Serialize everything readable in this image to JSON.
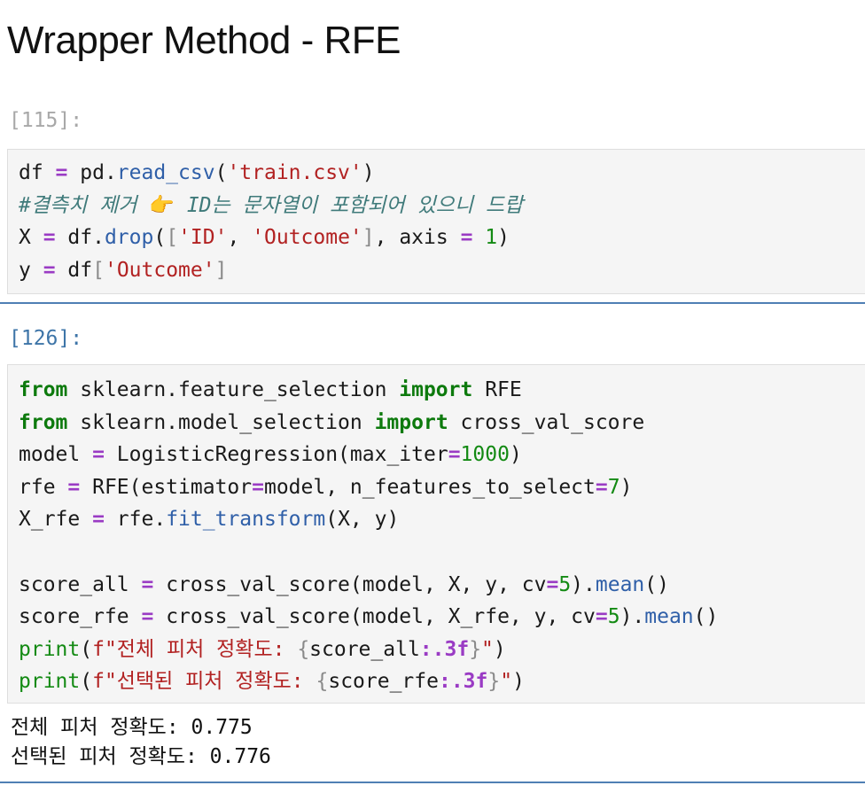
{
  "heading": "Wrapper Method - RFE",
  "cell1": {
    "prompt": "[115]:",
    "lines": [
      {
        "tokens": [
          {
            "t": "df ",
            "c": ""
          },
          {
            "t": "=",
            "c": "op"
          },
          {
            "t": " pd.",
            "c": ""
          },
          {
            "t": "read_csv",
            "c": "fn"
          },
          {
            "t": "(",
            "c": ""
          },
          {
            "t": "'train.csv'",
            "c": "str"
          },
          {
            "t": ")",
            "c": ""
          }
        ]
      },
      {
        "tokens": [
          {
            "t": "#결측치 제거 ",
            "c": "cm"
          },
          {
            "t": "👉",
            "c": "emoji"
          },
          {
            "t": " ID는 문자열이 포함되어 있으니 드랍",
            "c": "cm"
          }
        ]
      },
      {
        "tokens": [
          {
            "t": "X ",
            "c": ""
          },
          {
            "t": "=",
            "c": "op"
          },
          {
            "t": " df.",
            "c": ""
          },
          {
            "t": "drop",
            "c": "fn"
          },
          {
            "t": "(",
            "c": ""
          },
          {
            "t": "[",
            "c": "br"
          },
          {
            "t": "'ID'",
            "c": "str"
          },
          {
            "t": ", ",
            "c": ""
          },
          {
            "t": "'Outcome'",
            "c": "str"
          },
          {
            "t": "]",
            "c": "br"
          },
          {
            "t": ", axis ",
            "c": ""
          },
          {
            "t": "=",
            "c": "op"
          },
          {
            "t": " ",
            "c": ""
          },
          {
            "t": "1",
            "c": "num"
          },
          {
            "t": ")",
            "c": ""
          }
        ]
      },
      {
        "tokens": [
          {
            "t": "y ",
            "c": ""
          },
          {
            "t": "=",
            "c": "op"
          },
          {
            "t": " df",
            "c": ""
          },
          {
            "t": "[",
            "c": "br"
          },
          {
            "t": "'Outcome'",
            "c": "str"
          },
          {
            "t": "]",
            "c": "br"
          }
        ]
      }
    ]
  },
  "cell2": {
    "prompt": "[126]:",
    "lines": [
      {
        "tokens": [
          {
            "t": "from",
            "c": "kw"
          },
          {
            "t": " sklearn.feature_selection ",
            "c": ""
          },
          {
            "t": "import",
            "c": "kw"
          },
          {
            "t": " RFE",
            "c": ""
          }
        ]
      },
      {
        "tokens": [
          {
            "t": "from",
            "c": "kw"
          },
          {
            "t": " sklearn.model_selection ",
            "c": ""
          },
          {
            "t": "import",
            "c": "kw"
          },
          {
            "t": " cross_val_score",
            "c": ""
          }
        ]
      },
      {
        "tokens": [
          {
            "t": "model ",
            "c": ""
          },
          {
            "t": "=",
            "c": "op"
          },
          {
            "t": " LogisticRegression(max_iter",
            "c": ""
          },
          {
            "t": "=",
            "c": "op"
          },
          {
            "t": "1000",
            "c": "num"
          },
          {
            "t": ")",
            "c": ""
          }
        ]
      },
      {
        "tokens": [
          {
            "t": "rfe ",
            "c": ""
          },
          {
            "t": "=",
            "c": "op"
          },
          {
            "t": " RFE(estimator",
            "c": ""
          },
          {
            "t": "=",
            "c": "op"
          },
          {
            "t": "model, n_features_to_select",
            "c": ""
          },
          {
            "t": "=",
            "c": "op"
          },
          {
            "t": "7",
            "c": "num"
          },
          {
            "t": ")",
            "c": ""
          }
        ]
      },
      {
        "tokens": [
          {
            "t": "X_rfe ",
            "c": ""
          },
          {
            "t": "=",
            "c": "op"
          },
          {
            "t": " rfe.",
            "c": ""
          },
          {
            "t": "fit_transform",
            "c": "fn"
          },
          {
            "t": "(X, y)",
            "c": ""
          }
        ]
      },
      {
        "tokens": []
      },
      {
        "tokens": [
          {
            "t": "score_all ",
            "c": ""
          },
          {
            "t": "=",
            "c": "op"
          },
          {
            "t": " cross_val_score(model, X, y, cv",
            "c": ""
          },
          {
            "t": "=",
            "c": "op"
          },
          {
            "t": "5",
            "c": "num"
          },
          {
            "t": ").",
            "c": ""
          },
          {
            "t": "mean",
            "c": "fn"
          },
          {
            "t": "()",
            "c": ""
          }
        ]
      },
      {
        "tokens": [
          {
            "t": "score_rfe ",
            "c": ""
          },
          {
            "t": "=",
            "c": "op"
          },
          {
            "t": " cross_val_score(model, X_rfe, y, cv",
            "c": ""
          },
          {
            "t": "=",
            "c": "op"
          },
          {
            "t": "5",
            "c": "num"
          },
          {
            "t": ").",
            "c": ""
          },
          {
            "t": "mean",
            "c": "fn"
          },
          {
            "t": "()",
            "c": ""
          }
        ]
      },
      {
        "tokens": [
          {
            "t": "print",
            "c": "bi"
          },
          {
            "t": "(",
            "c": ""
          },
          {
            "t": "f\"전체 피처 정확도: ",
            "c": "fs"
          },
          {
            "t": "{",
            "c": "br"
          },
          {
            "t": "score_all",
            "c": ""
          },
          {
            "t": ":.3f",
            "c": "fmt"
          },
          {
            "t": "}",
            "c": "br"
          },
          {
            "t": "\"",
            "c": "fs"
          },
          {
            "t": ")",
            "c": ""
          }
        ]
      },
      {
        "tokens": [
          {
            "t": "print",
            "c": "bi"
          },
          {
            "t": "(",
            "c": ""
          },
          {
            "t": "f\"선택된 피처 정확도: ",
            "c": "fs"
          },
          {
            "t": "{",
            "c": "br"
          },
          {
            "t": "score_rfe",
            "c": ""
          },
          {
            "t": ":.3f",
            "c": "fmt"
          },
          {
            "t": "}",
            "c": "br"
          },
          {
            "t": "\"",
            "c": "fs"
          },
          {
            "t": ")",
            "c": ""
          }
        ]
      }
    ],
    "output": [
      "전체 피처 정확도: 0.775",
      "선택된 피처 정확도: 0.776"
    ]
  }
}
